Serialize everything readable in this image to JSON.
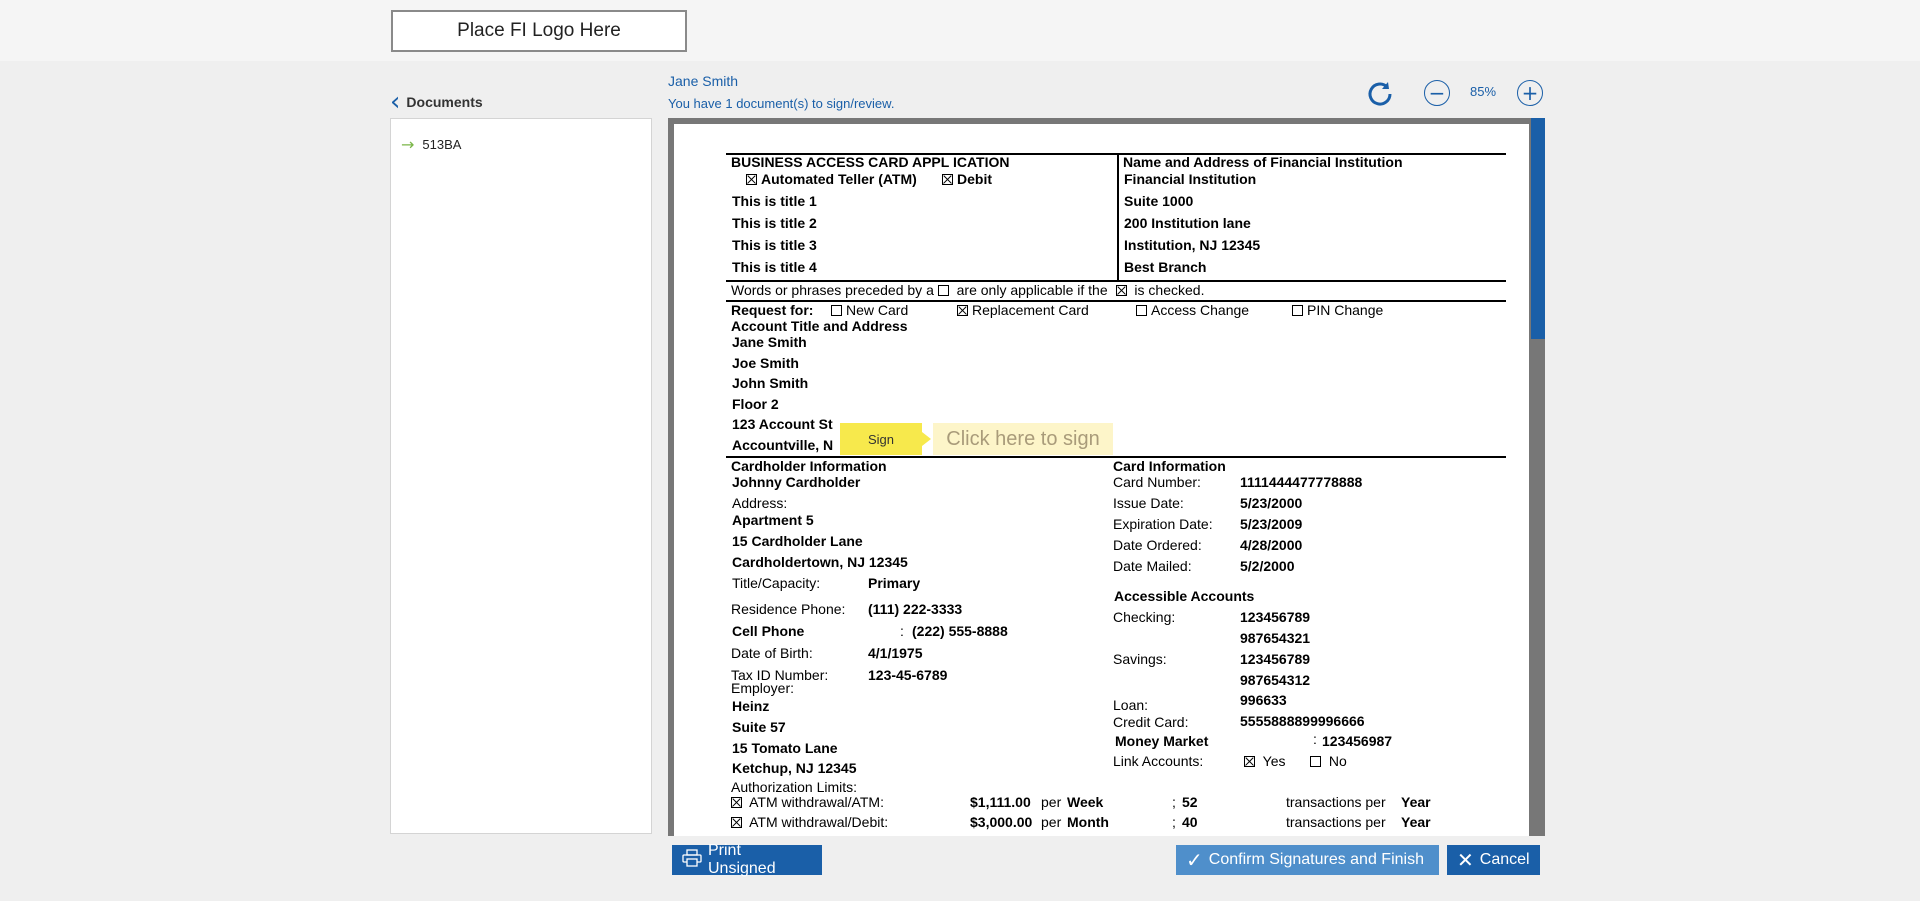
{
  "header": {
    "logo_text": "Place FI Logo Here"
  },
  "sidebar": {
    "title": "Documents",
    "items": [
      {
        "label": "513BA"
      }
    ]
  },
  "viewer_header": {
    "user_name": "Jane Smith",
    "status": "You have 1 document(s) to sign/review.",
    "zoom": "85%"
  },
  "document": {
    "title": "BUSINESS ACCESS CARD APPL ICATION",
    "card_types": [
      "Automated Teller (ATM)",
      "Debit"
    ],
    "titles": [
      "This is title 1",
      "This is title 2",
      "This is title 3",
      "This is title 4"
    ],
    "fi_heading": "Name and Address of Financial Institution",
    "fi_lines": [
      "Financial Institution",
      "Suite 1000",
      "200 Institution lane",
      "Institution, NJ 12345",
      "Best Branch"
    ],
    "words_note_1": "Words or phrases preceded by a",
    "words_note_2": "are only applicable if the",
    "words_note_3": "is checked.",
    "request_label": "Request for:",
    "request_options": [
      "New Card",
      "Replacement Card",
      "Access Change",
      "PIN Change"
    ],
    "account_heading": "Account Title and Address",
    "account_lines": [
      "Jane Smith",
      "Joe Smith",
      "John Smith",
      "Floor 2",
      "123 Account St",
      "Accountville, N"
    ],
    "cardholder": {
      "heading": "Cardholder Information",
      "name": "Johnny Cardholder",
      "address_label": "Address:",
      "address_lines": [
        "Apartment 5",
        "15 Cardholder Lane",
        "Cardholdertown, NJ 12345"
      ],
      "title_label": "Title/Capacity:",
      "title_value": "Primary",
      "res_phone_label": "Residence Phone:",
      "res_phone_value": "(111) 222-3333",
      "cell_label": "Cell Phone",
      "cell_sep": ":",
      "cell_value": "(222) 555-8888",
      "dob_label": "Date of Birth:",
      "dob_value": "4/1/1975",
      "tax_label": "Tax ID Number:",
      "tax_value": "123-45-6789",
      "employer_label": "Employer:",
      "employer_lines": [
        "Heinz",
        "Suite 57",
        "15 Tomato Lane",
        "Ketchup, NJ 12345"
      ],
      "auth_label": "Authorization Limits:"
    },
    "card_info": {
      "heading": "Card Information",
      "rows": [
        {
          "label": "Card Number:",
          "value": "1111444477778888"
        },
        {
          "label": "Issue Date:",
          "value": "5/23/2000"
        },
        {
          "label": "Expiration Date:",
          "value": "5/23/2009"
        },
        {
          "label": "Date Ordered:",
          "value": "4/28/2000"
        },
        {
          "label": "Date Mailed:",
          "value": "5/2/2000"
        }
      ]
    },
    "accounts": {
      "heading": "Accessible Accounts",
      "checking_label": "Checking:",
      "checking_values": [
        "123456789",
        "987654321"
      ],
      "savings_label": "Savings:",
      "savings_values": [
        "123456789",
        "987654312"
      ],
      "loan_label": "Loan:",
      "loan_value": "996633",
      "credit_label": "Credit Card:",
      "credit_value": "5555888899996666",
      "mm_label": "Money Market",
      "mm_sep": ":",
      "mm_value": "123456987",
      "link_label": "Link Accounts:",
      "link_yes": "Yes",
      "link_no": "No"
    },
    "limits": [
      {
        "label": "ATM withdrawal/ATM:",
        "amount": "$1,111.00",
        "per": "per",
        "period": "Week",
        "sep": ";",
        "count": "52",
        "tx": "transactions per",
        "tx_period": "Year"
      },
      {
        "label": "ATM withdrawal/Debit:",
        "amount": "$3,000.00",
        "per": "per",
        "period": "Month",
        "sep": ";",
        "count": "40",
        "tx": "transactions per",
        "tx_period": "Year"
      }
    ]
  },
  "sign": {
    "tag": "Sign",
    "hint": "Click here to sign"
  },
  "buttons": {
    "print": "Print Unsigned",
    "confirm": "Confirm Signatures and Finish",
    "cancel": "Cancel"
  }
}
